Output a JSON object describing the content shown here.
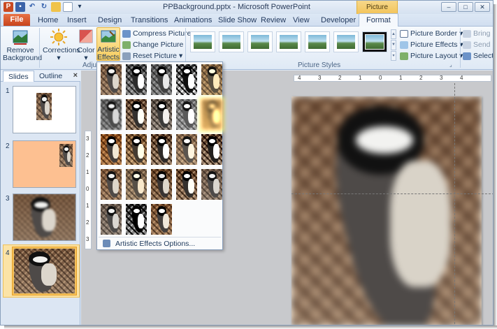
{
  "window": {
    "title": "PPBackground.pptx - Microsoft PowerPoint",
    "contextual_tab_group": "Picture Tools"
  },
  "quick_access": {
    "app_icon": "P",
    "undo_glyph": "↶",
    "redo_glyph": "↻"
  },
  "tabs": {
    "file": "File",
    "items": [
      "Home",
      "Insert",
      "Design",
      "Transitions",
      "Animations",
      "Slide Show",
      "Review",
      "View",
      "Developer",
      "Format"
    ],
    "active": "Format"
  },
  "ribbon": {
    "remove_background": "Remove Background",
    "corrections": "Corrections",
    "color": "Color",
    "artistic_effects": "Artistic Effects",
    "compress_pictures": "Compress Pictures",
    "change_picture": "Change Picture",
    "reset_picture": "Reset Picture",
    "adjust_group": "Adju",
    "picture_styles_group": "Picture Styles",
    "picture_border": "Picture Border",
    "picture_effects": "Picture Effects",
    "picture_layout": "Picture Layout",
    "bring_forward": "Bring Fo",
    "send_backward": "Send Ba",
    "selection": "Selectio"
  },
  "panel": {
    "tab_slides": "Slides",
    "tab_outline": "Outline",
    "close": "×",
    "slides": [
      {
        "number": "1"
      },
      {
        "number": "2",
        "background": "#fdc091"
      },
      {
        "number": "3"
      },
      {
        "number": "4",
        "selected": true
      }
    ]
  },
  "rulers": {
    "horizontal": [
      "4",
      "3",
      "2",
      "1",
      "0",
      "1",
      "2",
      "3",
      "4"
    ],
    "vertical": [
      "3",
      "2",
      "1",
      "0",
      "1",
      "2",
      "3"
    ]
  },
  "artistic_effects_menu": {
    "options_label": "Artistic Effects Options...",
    "highlighted_index": 9,
    "effect_count": 23
  },
  "colors": {
    "accent": "#f2c45b",
    "file_tab": "#c7441b",
    "slide2_background": "#fdc091"
  }
}
